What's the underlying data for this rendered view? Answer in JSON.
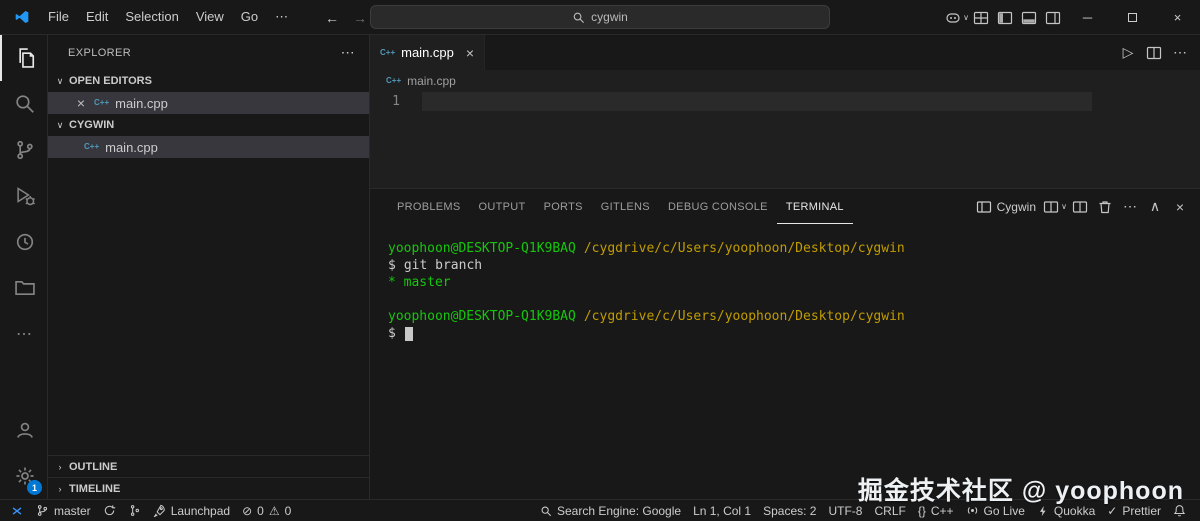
{
  "colors": {
    "accent_blue": "#0078d4",
    "titlebar_bg": "#181818",
    "editor_bg": "#1f1f1f",
    "selection_bg": "#37373d",
    "terminal_green": "#16c60c",
    "terminal_yellow": "#c19c00",
    "foreground": "#cccccc"
  },
  "icons": {
    "cpp": "C++",
    "close": "×",
    "more": "⋯",
    "minimize": "─",
    "chevron_down": "∨",
    "chevron_up": "∧",
    "chevron_right": "›",
    "back_arrow": "←",
    "forward_arrow": "→",
    "run": "▷",
    "errors": "⊘",
    "warnings": "⚠",
    "braces": "{}",
    "check": "✓"
  },
  "titlebar": {
    "menus": [
      "File",
      "Edit",
      "Selection",
      "View",
      "Go"
    ],
    "search_value": "cygwin"
  },
  "activitybar": {
    "settings_badge": "1"
  },
  "sidebar": {
    "title": "EXPLORER",
    "open_editors_label": "OPEN EDITORS",
    "open_editors": [
      {
        "name": "main.cpp"
      }
    ],
    "workspace_label": "CYGWIN",
    "files": [
      {
        "name": "main.cpp"
      }
    ],
    "outline_label": "OUTLINE",
    "timeline_label": "TIMELINE"
  },
  "editor": {
    "tabs": [
      {
        "label": "main.cpp"
      }
    ],
    "breadcrumb": "main.cpp",
    "line_number": "1"
  },
  "panel": {
    "tabs": [
      "PROBLEMS",
      "OUTPUT",
      "PORTS",
      "GITLENS",
      "DEBUG CONSOLE",
      "TERMINAL"
    ],
    "active_tab": "TERMINAL",
    "profile_label": "Cygwin"
  },
  "terminal": {
    "user": "yoophoon@DESKTOP-Q1K9BAQ",
    "path": "/cygdrive/c/Users/yoophoon/Desktop/cygwin",
    "prompt": "$",
    "command": "git branch",
    "output": "* master"
  },
  "statusbar": {
    "branch": "master",
    "errors": "0",
    "warnings": "0",
    "launchpad": "Launchpad",
    "search_engine": "Search Engine: Google",
    "cursor_position": "Ln 1, Col 1",
    "indentation": "Spaces: 2",
    "encoding": "UTF-8",
    "eol": "CRLF",
    "language": "C++",
    "go_live": "Go Live",
    "quokka": "Quokka",
    "prettier": "Prettier"
  },
  "watermark": "掘金技术社区 @ yoophoon"
}
